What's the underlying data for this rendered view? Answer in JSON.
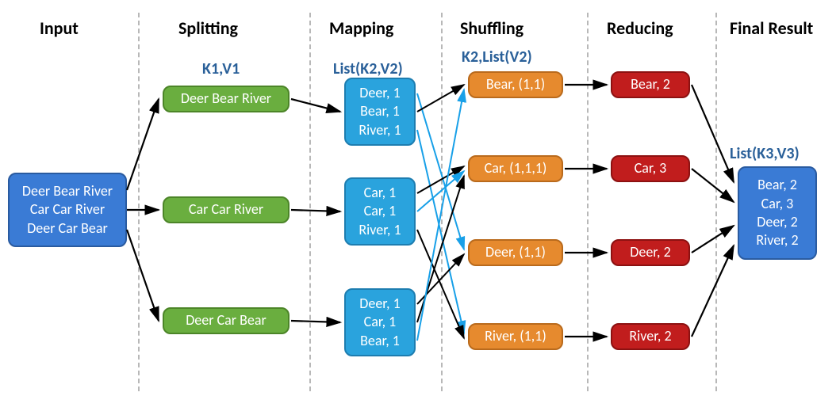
{
  "headings": {
    "input": "Input",
    "splitting": "Splitting",
    "mapping": "Mapping",
    "shuffling": "Shuffling",
    "reducing": "Reducing",
    "final": "Final Result"
  },
  "subheadings": {
    "splitting": "K1,V1",
    "mapping": "List(K2,V2)",
    "shuffling": "K2,List(V2)",
    "final": "List(K3,V3)"
  },
  "input": {
    "lines": [
      "Deer Bear River",
      "Car Car River",
      "Deer Car Bear"
    ]
  },
  "splitting": {
    "items": [
      "Deer Bear River",
      "Car Car River",
      "Deer Car Bear"
    ]
  },
  "mapping": {
    "groups": [
      [
        "Deer, 1",
        "Bear, 1",
        "River, 1"
      ],
      [
        "Car, 1",
        "Car, 1",
        "River, 1"
      ],
      [
        "Deer, 1",
        "Car, 1",
        "Bear, 1"
      ]
    ]
  },
  "shuffling": {
    "items": [
      "Bear, (1,1)",
      "Car, (1,1,1)",
      "Deer, (1,1)",
      "River, (1,1)"
    ]
  },
  "reducing": {
    "items": [
      "Bear, 2",
      "Car, 3",
      "Deer, 2",
      "River, 2"
    ]
  },
  "final": {
    "lines": [
      "Bear, 2",
      "Car, 3",
      "Deer, 2",
      "River, 2"
    ]
  },
  "chart_data": {
    "type": "flow",
    "stages": [
      "Input",
      "Splitting",
      "Mapping",
      "Shuffling",
      "Reducing",
      "Final Result"
    ],
    "stage_labels": {
      "Splitting": "K1,V1",
      "Mapping": "List(K2,V2)",
      "Shuffling": "K2,List(V2)",
      "Final Result": "List(K3,V3)"
    },
    "input_lines": [
      "Deer Bear River",
      "Car Car River",
      "Deer Car Bear"
    ],
    "splitting": [
      "Deer Bear River",
      "Car Car River",
      "Deer Car Bear"
    ],
    "mapping": [
      [
        [
          "Deer",
          1
        ],
        [
          "Bear",
          1
        ],
        [
          "River",
          1
        ]
      ],
      [
        [
          "Car",
          1
        ],
        [
          "Car",
          1
        ],
        [
          "River",
          1
        ]
      ],
      [
        [
          "Deer",
          1
        ],
        [
          "Car",
          1
        ],
        [
          "Bear",
          1
        ]
      ]
    ],
    "shuffling": {
      "Bear": [
        1,
        1
      ],
      "Car": [
        1,
        1,
        1
      ],
      "Deer": [
        1,
        1
      ],
      "River": [
        1,
        1
      ]
    },
    "reducing": {
      "Bear": 2,
      "Car": 3,
      "Deer": 2,
      "River": 2
    },
    "final_result": [
      [
        "Bear",
        2
      ],
      [
        "Car",
        3
      ],
      [
        "Deer",
        2
      ],
      [
        "River",
        2
      ]
    ]
  }
}
